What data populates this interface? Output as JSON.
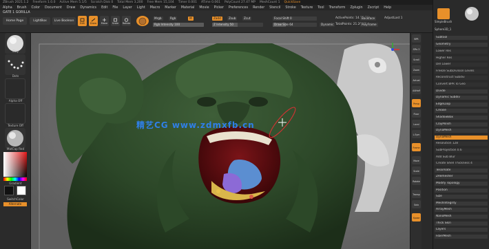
{
  "titlebar": {
    "items": [
      "ZBrush 2021.1.2",
      "Freeform 1.0.0",
      "Active Mem 5.1/5",
      "Scratch Disk 0",
      "Total Mem 3,200",
      "Free Mem 15,104",
      "Timer 0.001",
      "ATime 0.061",
      "PolyCount 27.47 MP",
      "MeshCount 1"
    ],
    "quicksave": "QuickSave"
  },
  "menubar": {
    "items": [
      "Alpha",
      "Brush",
      "Color",
      "Document",
      "Draw",
      "Dynamics",
      "Edit",
      "File",
      "Layer",
      "Light",
      "Macro",
      "Marker",
      "Material",
      "Movie",
      "Picker",
      "Preferences",
      "Render",
      "Stencil",
      "Stroke",
      "Texture",
      "Tool",
      "Transform",
      "Zplugin",
      "Zscript",
      "Help"
    ]
  },
  "filename": "GATE 1 GORILLA",
  "topshelf": {
    "home_page": "Home Page",
    "lightbox": "LightBox",
    "live_boolean": "Live Boolean",
    "edit": "Edit",
    "draw": "Draw",
    "move": "Move",
    "scale": "Scale",
    "rotate": "Rotate",
    "mrgb": "Mrgb",
    "rgb": "Rgb",
    "m": "M",
    "zadd": "Zadd",
    "zsub": "Zsub",
    "zcut": "Zcut",
    "rgb_intensity": "Rgb Intensity 100",
    "z_intensity": "Z Intensity 50",
    "focal_shift": "Focal Shift 0",
    "draw_size": "Draw Size 64",
    "dynamic": "Dynamic",
    "active_points": "ActivePoints: 14.09 Mil",
    "total_points": "TotalPoints: 21.26 Mil",
    "backface": "Backface",
    "polyframe": "PolyFrame",
    "adjust_last": "AdjustLast 1"
  },
  "leftpanel": {
    "clay_label": "Clay",
    "dots_label": "Dots",
    "alpha_label": "Alpha Off",
    "texture_label": "Texture Off",
    "material_label": "MatCap Red",
    "gradient_label": "Gradient",
    "switch_label": "SwitchColor",
    "alternate_label": "Alternate"
  },
  "rightstrip": {
    "buttons": [
      "BPR",
      "SPix 3",
      "Scroll",
      "Zoom",
      "Actual",
      "AAHalf",
      "Persp",
      "Floor",
      "Local",
      "L.Sym",
      "Frame",
      "Move",
      "Scale",
      "Rotate",
      "Transp",
      "Solo",
      "Xpose"
    ]
  },
  "rightpanel": {
    "title": "SimpleBrush",
    "spheredmesh": "Sphere3D_1",
    "subtool_label": "Subtool",
    "geometry": "Geometry",
    "rows": [
      {
        "text": "Lower Res",
        "style": "sub"
      },
      {
        "text": "Higher Res",
        "style": "sub"
      },
      {
        "text": "Del Lower",
        "style": "sub"
      },
      {
        "text": "Freeze SubDivision Levels",
        "style": "sub"
      },
      {
        "text": "Reconstruct Subdiv",
        "style": "sub"
      },
      {
        "text": "Convert BPR To Geo",
        "style": "sub"
      },
      {
        "text": "Divide",
        "style": "head"
      },
      {
        "text": "Dynamic Subdiv",
        "style": "head"
      },
      {
        "text": "EdgeLoop",
        "style": "head"
      },
      {
        "text": "Crease",
        "style": "head"
      },
      {
        "text": "ShadowBox",
        "style": "head"
      },
      {
        "text": "ClayPolish",
        "style": "head"
      },
      {
        "text": "DynaMesh",
        "style": "head"
      },
      {
        "text": "DynaMesh",
        "style": "orange"
      },
      {
        "text": "Resolution 128",
        "style": "sub"
      },
      {
        "text": "SubProjection 0.6",
        "style": "sub"
      },
      {
        "text": "Add Sub Blur",
        "style": "sub"
      },
      {
        "text": "Create Shell Thickness 4",
        "style": "sub"
      },
      {
        "text": "Tessimate",
        "style": "head"
      },
      {
        "text": "ZRemesher",
        "style": "head"
      },
      {
        "text": "Modify Topology",
        "style": "head"
      },
      {
        "text": "Position",
        "style": "head"
      },
      {
        "text": "Size",
        "style": "head"
      },
      {
        "text": "MeshIntegrity",
        "style": "head"
      },
      {
        "text": "ArrayMesh",
        "style": "head"
      },
      {
        "text": "NanoMesh",
        "style": "head"
      },
      {
        "text": "Thick Skin",
        "style": "head"
      },
      {
        "text": "Layers",
        "style": "head"
      },
      {
        "text": "FiberMesh",
        "style": "head"
      }
    ]
  },
  "watermark": "精艺CG  www.zdmxfb.cn",
  "colors": {
    "accent": "#e8902a",
    "panel": "#2a2a2a",
    "model": "#2f4a2c",
    "viewport": "#6c6c6c"
  }
}
